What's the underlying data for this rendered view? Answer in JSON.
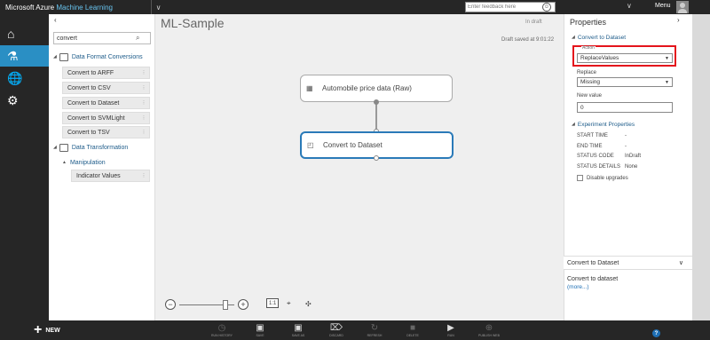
{
  "topbar": {
    "brand_prefix": "Microsoft Azure",
    "brand_product": "Machine Learning",
    "feedback_placeholder": "Enter feedback here",
    "menu_label": "Menu"
  },
  "rail": {
    "accent_color": "#2a8fc4"
  },
  "palette": {
    "search_value": "convert",
    "categories": [
      {
        "label": "Data Format Conversions"
      },
      {
        "label": "Data Transformation"
      }
    ],
    "modules": [
      "Convert to ARFF",
      "Convert to CSV",
      "Convert to Dataset",
      "Convert to SVMLight",
      "Convert to TSV"
    ],
    "subcategory": "Manipulation",
    "sub_modules": [
      "Indicator Values"
    ]
  },
  "canvas": {
    "title": "ML-Sample",
    "state": "In draft",
    "saved": "Draft saved at 9:01:22",
    "nodes": [
      {
        "label": "Automobile price data (Raw)"
      },
      {
        "label": "Convert to Dataset"
      }
    ],
    "fit_label": "1:1"
  },
  "properties": {
    "title": "Properties",
    "section": "Convert to Dataset",
    "action_label": "Action",
    "action_value": "ReplaceValues",
    "replace_label": "Replace",
    "replace_value": "Missing",
    "newvalue_label": "New value",
    "newvalue_value": "0",
    "exp_section": "Experiment Properties",
    "exp_props": [
      {
        "key": "START TIME",
        "value": "-"
      },
      {
        "key": "END TIME",
        "value": "-"
      },
      {
        "key": "STATUS CODE",
        "value": "InDraft"
      },
      {
        "key": "STATUS DETAILS",
        "value": "None"
      }
    ],
    "disable_upgrades": "Disable upgrades",
    "help_title": "Convert to Dataset",
    "help_desc": "Convert to dataset",
    "help_more": "(more...)"
  },
  "bottombar": {
    "new_label": "NEW",
    "buttons": [
      {
        "label": "RUN HISTORY",
        "icon": "clock-icon"
      },
      {
        "label": "SAVE",
        "icon": "save-icon"
      },
      {
        "label": "SAVE AS",
        "icon": "save-as-icon"
      },
      {
        "label": "DISCARD",
        "icon": "trash-icon"
      },
      {
        "label": "REFRESH",
        "icon": "refresh-icon"
      },
      {
        "label": "DELETE",
        "icon": "stop-icon"
      },
      {
        "label": "RUN",
        "icon": "play-icon"
      },
      {
        "label": "PUBLISH WEB",
        "icon": "globe-icon"
      }
    ],
    "help": "?"
  }
}
